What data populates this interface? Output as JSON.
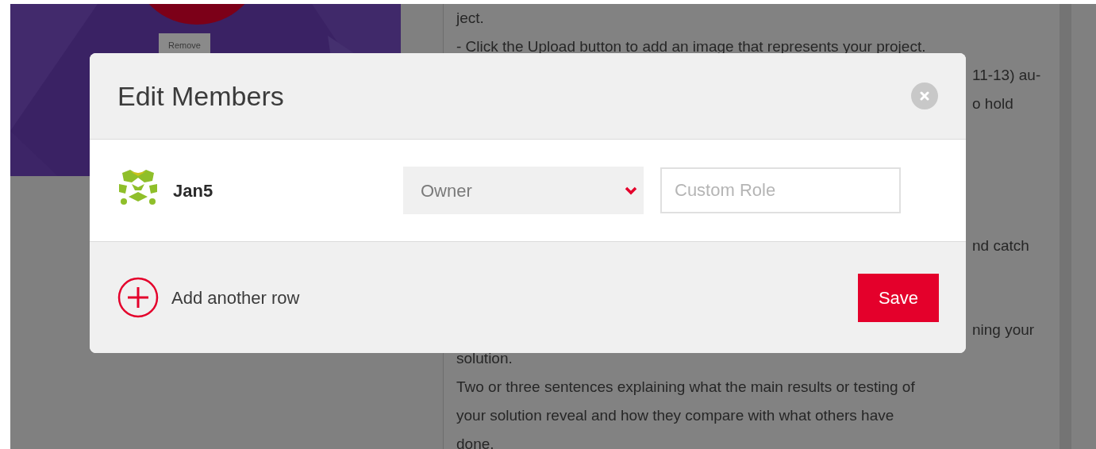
{
  "background": {
    "remove_button": "Remove",
    "text_lines": [
      {
        "text": "ject.",
        "kind": "line"
      },
      {
        "text": "- Click the Upload button to add an image that represents your project.",
        "kind": "line"
      },
      {
        "text": "11-13) au-",
        "kind": "fragment"
      },
      {
        "text": "o hold",
        "kind": "fragment"
      },
      {
        "text": "nd catch",
        "kind": "fragment"
      },
      {
        "text": "ning your",
        "kind": "fragment"
      },
      {
        "text": "solution.",
        "kind": "line"
      },
      {
        "text": "Two or three sentences explaining what the main results or testing of",
        "kind": "line"
      },
      {
        "text": "your solution reveal and how they compare with what others have",
        "kind": "line"
      },
      {
        "text": "done.",
        "kind": "line"
      }
    ]
  },
  "dialog": {
    "title": "Edit Members",
    "members": [
      {
        "name": "Jan5",
        "role": "Owner",
        "custom_role_placeholder": "Custom Role"
      }
    ],
    "add_row": "Add another row",
    "save": "Save"
  }
}
